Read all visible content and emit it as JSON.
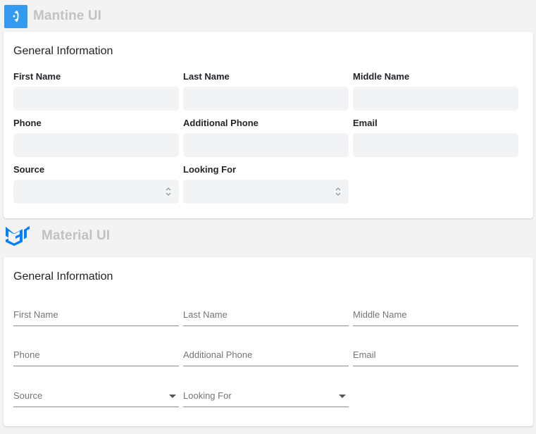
{
  "mantine": {
    "brand_name": "Mantine UI",
    "logo_icon": "mantine-logo-icon",
    "accent_color": "#339af0",
    "card": {
      "title": "General Information",
      "fields": {
        "first_name": "First Name",
        "last_name": "Last Name",
        "middle_name": "Middle Name",
        "phone": "Phone",
        "additional_phone": "Additional Phone",
        "email": "Email",
        "source": "Source",
        "looking_for": "Looking For"
      },
      "values": {
        "first_name": "",
        "last_name": "",
        "middle_name": "",
        "phone": "",
        "additional_phone": "",
        "email": "",
        "source": "",
        "looking_for": ""
      }
    }
  },
  "mui": {
    "brand_name": "Material UI",
    "logo_icon": "material-ui-logo-icon",
    "accent_color": "#007fff",
    "card": {
      "title": "General Information",
      "fields": {
        "first_name": "First Name",
        "last_name": "Last Name",
        "middle_name": "Middle Name",
        "phone": "Phone",
        "additional_phone": "Additional Phone",
        "email": "Email",
        "source": "Source",
        "looking_for": "Looking For"
      }
    }
  }
}
